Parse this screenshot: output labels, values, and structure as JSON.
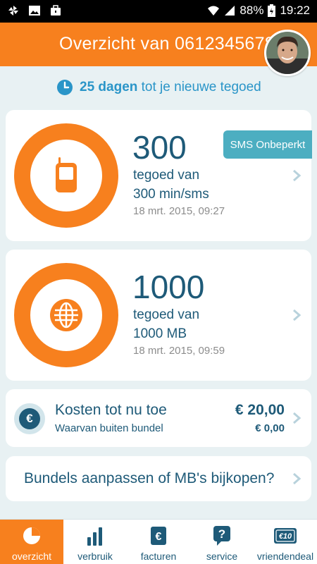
{
  "status_bar": {
    "battery": "88%",
    "time": "19:22"
  },
  "header": {
    "title": "Overzicht van 0612345678"
  },
  "info": {
    "days": "25 dagen",
    "text": "tot je nieuwe tegoed"
  },
  "card_minutes": {
    "value": "300",
    "line1": "tegoed van",
    "line2": "300 min/sms",
    "timestamp": "18 mrt. 2015, 09:27",
    "badge": "SMS Onbeperkt"
  },
  "card_data": {
    "value": "1000",
    "line1": "tegoed van",
    "line2": "1000 MB",
    "timestamp": "18 mrt. 2015, 09:59"
  },
  "costs": {
    "currency_symbol": "€",
    "title": "Kosten tot nu toe",
    "subtitle": "Waarvan buiten bundel",
    "total": "€ 20,00",
    "outside": "€ 0,00"
  },
  "bundles": {
    "label": "Bundels aanpassen of MB's bijkopen?"
  },
  "nav": {
    "items": [
      {
        "label": "overzicht",
        "icon": "pie-clock-icon",
        "active": true
      },
      {
        "label": "verbruik",
        "icon": "bar-chart-icon",
        "active": false
      },
      {
        "label": "facturen",
        "icon": "euro-invoice-icon",
        "active": false
      },
      {
        "label": "service",
        "icon": "help-bubble-icon",
        "active": false
      },
      {
        "label": "vriendendeal",
        "icon": "ticket-10-icon",
        "active": false
      }
    ],
    "ticket_text": "€10"
  },
  "colors": {
    "accent": "#f7801e",
    "primary_text": "#1e5a78",
    "info_blue": "#2a95c8",
    "badge": "#4caec1",
    "background": "#e8f1f3"
  }
}
